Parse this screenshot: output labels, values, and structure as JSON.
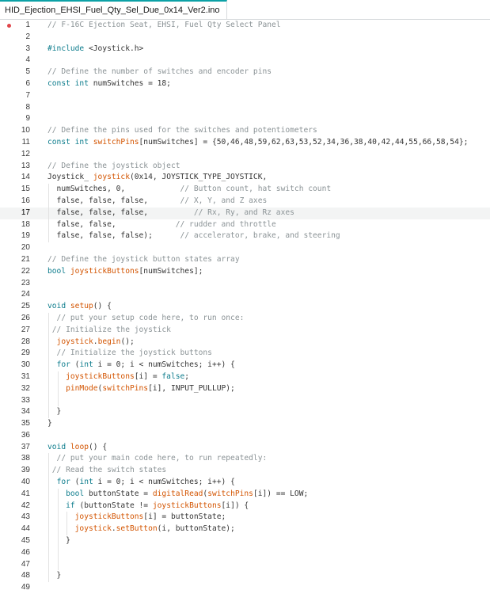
{
  "tab": {
    "title": "HID_Ejection_EHSI_Fuel_Qty_Sel_Due_0x14_Ver2.ino"
  },
  "colors": {
    "comment": "#8b9396",
    "keyword": "#0c7c8c",
    "function": "#d35400",
    "text": "#343434",
    "breakpoint": "#e0464b",
    "tab_accent": "#0ca1a6"
  },
  "editor": {
    "current_line": 17,
    "breakpoint_line": 1,
    "lines": [
      {
        "n": "1",
        "indent": 0,
        "tokens": [
          {
            "t": "// F-16C Ejection Seat, EHSI, Fuel Qty Select Panel",
            "c": "c"
          }
        ]
      },
      {
        "n": "2",
        "indent": 0,
        "tokens": []
      },
      {
        "n": "3",
        "indent": 0,
        "tokens": [
          {
            "t": "#include ",
            "c": "k"
          },
          {
            "t": "<Joystick.h>",
            "c": "n"
          }
        ]
      },
      {
        "n": "4",
        "indent": 0,
        "tokens": []
      },
      {
        "n": "5",
        "indent": 0,
        "tokens": [
          {
            "t": "// Define the number of switches and encoder pins",
            "c": "c"
          }
        ]
      },
      {
        "n": "6",
        "indent": 0,
        "tokens": [
          {
            "t": "const int",
            "c": "k"
          },
          {
            "t": " numSwitches = 18;",
            "c": "n"
          }
        ]
      },
      {
        "n": "7",
        "indent": 0,
        "tokens": []
      },
      {
        "n": "8",
        "indent": 0,
        "tokens": []
      },
      {
        "n": "9",
        "indent": 0,
        "tokens": []
      },
      {
        "n": "10",
        "indent": 0,
        "tokens": [
          {
            "t": "// Define the pins used for the switches and potentiometers",
            "c": "c"
          }
        ]
      },
      {
        "n": "11",
        "indent": 0,
        "tokens": [
          {
            "t": "const int",
            "c": "k"
          },
          {
            "t": " ",
            "c": "n"
          },
          {
            "t": "switchPins",
            "c": "f"
          },
          {
            "t": "[numSwitches] = {50,46,48,59,62,63,53,52,34,36,38,40,42,44,55,66,58,54};",
            "c": "n"
          }
        ]
      },
      {
        "n": "12",
        "indent": 0,
        "tokens": []
      },
      {
        "n": "13",
        "indent": 0,
        "tokens": [
          {
            "t": "// Define the joystick object",
            "c": "c"
          }
        ]
      },
      {
        "n": "14",
        "indent": 0,
        "tokens": [
          {
            "t": "Joystick_ ",
            "c": "n"
          },
          {
            "t": "joystick",
            "c": "f"
          },
          {
            "t": "(0x14, JOYSTICK_TYPE_JOYSTICK,",
            "c": "n"
          }
        ]
      },
      {
        "n": "15",
        "indent": 1,
        "tokens": [
          {
            "t": "  numSwitches, 0,            ",
            "c": "n"
          },
          {
            "t": "// Button count, hat switch count",
            "c": "c"
          }
        ]
      },
      {
        "n": "16",
        "indent": 1,
        "tokens": [
          {
            "t": "  false, false, false,       ",
            "c": "n"
          },
          {
            "t": "// X, Y, and Z axes",
            "c": "c"
          }
        ]
      },
      {
        "n": "17",
        "indent": 1,
        "tokens": [
          {
            "t": "  false, false, false,          ",
            "c": "n"
          },
          {
            "t": "// Rx, Ry, and Rz axes",
            "c": "c"
          }
        ]
      },
      {
        "n": "18",
        "indent": 1,
        "tokens": [
          {
            "t": "  false, false,             ",
            "c": "n"
          },
          {
            "t": "// rudder and throttle",
            "c": "c"
          }
        ]
      },
      {
        "n": "19",
        "indent": 1,
        "tokens": [
          {
            "t": "  false, false, false);      ",
            "c": "n"
          },
          {
            "t": "// accelerator, brake, and steering",
            "c": "c"
          }
        ]
      },
      {
        "n": "20",
        "indent": 0,
        "tokens": []
      },
      {
        "n": "21",
        "indent": 0,
        "tokens": [
          {
            "t": "// Define the joystick button states array",
            "c": "c"
          }
        ]
      },
      {
        "n": "22",
        "indent": 0,
        "tokens": [
          {
            "t": "bool",
            "c": "k"
          },
          {
            "t": " ",
            "c": "n"
          },
          {
            "t": "joystickButtons",
            "c": "f"
          },
          {
            "t": "[numSwitches];",
            "c": "n"
          }
        ]
      },
      {
        "n": "23",
        "indent": 0,
        "tokens": []
      },
      {
        "n": "24",
        "indent": 0,
        "tokens": []
      },
      {
        "n": "25",
        "indent": 0,
        "tokens": [
          {
            "t": "void",
            "c": "k"
          },
          {
            "t": " ",
            "c": "n"
          },
          {
            "t": "setup",
            "c": "f"
          },
          {
            "t": "() {",
            "c": "n"
          }
        ]
      },
      {
        "n": "26",
        "indent": 1,
        "tokens": [
          {
            "t": "  // put your setup code here, to run once:",
            "c": "c"
          }
        ]
      },
      {
        "n": "27",
        "indent": 1,
        "tokens": [
          {
            "t": " // Initialize the joystick",
            "c": "c"
          }
        ]
      },
      {
        "n": "28",
        "indent": 1,
        "tokens": [
          {
            "t": "  ",
            "c": "n"
          },
          {
            "t": "joystick",
            "c": "f"
          },
          {
            "t": ".",
            "c": "n"
          },
          {
            "t": "begin",
            "c": "f"
          },
          {
            "t": "();",
            "c": "n"
          }
        ]
      },
      {
        "n": "29",
        "indent": 1,
        "tokens": [
          {
            "t": "  // Initialize the joystick buttons",
            "c": "c"
          }
        ]
      },
      {
        "n": "30",
        "indent": 1,
        "tokens": [
          {
            "t": "  ",
            "c": "n"
          },
          {
            "t": "for",
            "c": "k"
          },
          {
            "t": " (",
            "c": "n"
          },
          {
            "t": "int",
            "c": "k"
          },
          {
            "t": " i = 0; i < numSwitches; i++) {",
            "c": "n"
          }
        ]
      },
      {
        "n": "31",
        "indent": 2,
        "tokens": [
          {
            "t": "    ",
            "c": "n"
          },
          {
            "t": "joystickButtons",
            "c": "f"
          },
          {
            "t": "[i] = ",
            "c": "n"
          },
          {
            "t": "false",
            "c": "k"
          },
          {
            "t": ";",
            "c": "n"
          }
        ]
      },
      {
        "n": "32",
        "indent": 2,
        "tokens": [
          {
            "t": "    ",
            "c": "n"
          },
          {
            "t": "pinMode",
            "c": "f"
          },
          {
            "t": "(",
            "c": "n"
          },
          {
            "t": "switchPins",
            "c": "f"
          },
          {
            "t": "[i], INPUT_PULLUP);",
            "c": "n"
          }
        ]
      },
      {
        "n": "33",
        "indent": 2,
        "tokens": []
      },
      {
        "n": "34",
        "indent": 1,
        "tokens": [
          {
            "t": "  }",
            "c": "n"
          }
        ]
      },
      {
        "n": "35",
        "indent": 0,
        "tokens": [
          {
            "t": "}",
            "c": "n"
          }
        ]
      },
      {
        "n": "36",
        "indent": 0,
        "tokens": []
      },
      {
        "n": "37",
        "indent": 0,
        "tokens": [
          {
            "t": "void",
            "c": "k"
          },
          {
            "t": " ",
            "c": "n"
          },
          {
            "t": "loop",
            "c": "f"
          },
          {
            "t": "() {",
            "c": "n"
          }
        ]
      },
      {
        "n": "38",
        "indent": 1,
        "tokens": [
          {
            "t": "  // put your main code here, to run repeatedly:",
            "c": "c"
          }
        ]
      },
      {
        "n": "39",
        "indent": 1,
        "tokens": [
          {
            "t": " // Read the switch states",
            "c": "c"
          }
        ]
      },
      {
        "n": "40",
        "indent": 1,
        "tokens": [
          {
            "t": "  ",
            "c": "n"
          },
          {
            "t": "for",
            "c": "k"
          },
          {
            "t": " (",
            "c": "n"
          },
          {
            "t": "int",
            "c": "k"
          },
          {
            "t": " i = 0; i < numSwitches; i++) {",
            "c": "n"
          }
        ]
      },
      {
        "n": "41",
        "indent": 2,
        "tokens": [
          {
            "t": "    ",
            "c": "n"
          },
          {
            "t": "bool",
            "c": "k"
          },
          {
            "t": " buttonState = ",
            "c": "n"
          },
          {
            "t": "digitalRead",
            "c": "f"
          },
          {
            "t": "(",
            "c": "n"
          },
          {
            "t": "switchPins",
            "c": "f"
          },
          {
            "t": "[i]) == LOW;",
            "c": "n"
          }
        ]
      },
      {
        "n": "42",
        "indent": 2,
        "tokens": [
          {
            "t": "    ",
            "c": "n"
          },
          {
            "t": "if",
            "c": "k"
          },
          {
            "t": " (buttonState != ",
            "c": "n"
          },
          {
            "t": "joystickButtons",
            "c": "f"
          },
          {
            "t": "[i]) {",
            "c": "n"
          }
        ]
      },
      {
        "n": "43",
        "indent": 3,
        "tokens": [
          {
            "t": "      ",
            "c": "n"
          },
          {
            "t": "joystickButtons",
            "c": "f"
          },
          {
            "t": "[i] = buttonState;",
            "c": "n"
          }
        ]
      },
      {
        "n": "44",
        "indent": 3,
        "tokens": [
          {
            "t": "      ",
            "c": "n"
          },
          {
            "t": "joystick",
            "c": "f"
          },
          {
            "t": ".",
            "c": "n"
          },
          {
            "t": "setButton",
            "c": "f"
          },
          {
            "t": "(i, buttonState);",
            "c": "n"
          }
        ]
      },
      {
        "n": "45",
        "indent": 2,
        "tokens": [
          {
            "t": "    }",
            "c": "n"
          }
        ]
      },
      {
        "n": "46",
        "indent": 2,
        "tokens": []
      },
      {
        "n": "47",
        "indent": 2,
        "tokens": []
      },
      {
        "n": "48",
        "indent": 1,
        "tokens": [
          {
            "t": "  }",
            "c": "n"
          }
        ]
      },
      {
        "n": "49",
        "indent": 0,
        "tokens": []
      }
    ]
  }
}
